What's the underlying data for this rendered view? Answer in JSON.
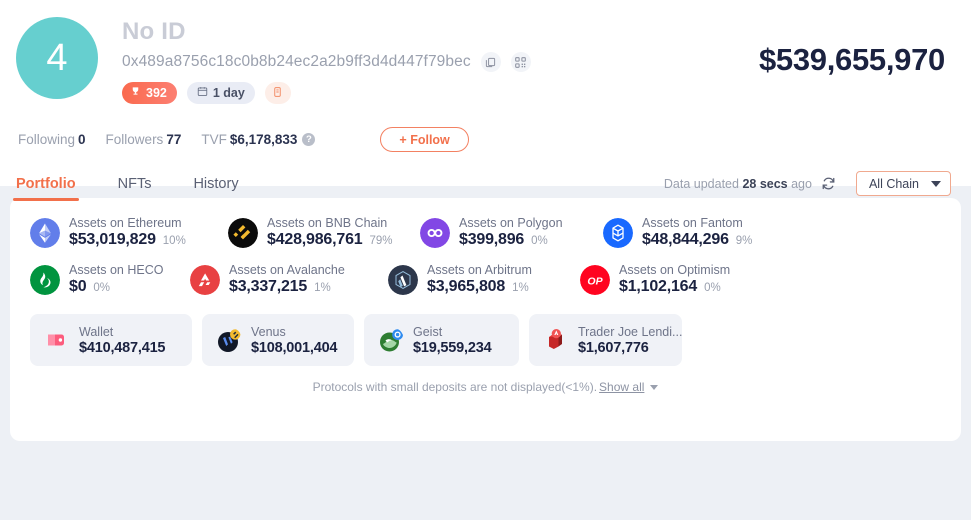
{
  "profile": {
    "avatar_rank": "4",
    "display_name": "No ID",
    "address": "0x489a8756c18c0b8b24ec2a2b9ff3d4d447f79bec",
    "copy_icon": "copy-icon",
    "qr_icon": "qr-code-icon",
    "badges": {
      "rank_icon": "trophy-icon",
      "rank_value": "392",
      "duration_icon": "calendar-icon",
      "duration_value": "1 day",
      "note_icon": "note-icon"
    },
    "total_value": "$539,655,970"
  },
  "stats": {
    "following_label": "Following",
    "following_value": "0",
    "followers_label": "Followers",
    "followers_value": "77",
    "tvf_label": "TVF",
    "tvf_value": "$6,178,833",
    "tvf_help_icon": "question-mark-icon",
    "follow_button": "+ Follow"
  },
  "tabs": [
    {
      "label": "Portfolio",
      "active": true
    },
    {
      "label": "NFTs",
      "active": false
    },
    {
      "label": "History",
      "active": false
    }
  ],
  "toolbar": {
    "updated_prefix": "Data updated",
    "updated_time": "28 secs",
    "updated_suffix": "ago",
    "refresh_icon": "refresh-icon",
    "chain_filter": "All Chain",
    "chain_caret_icon": "chevron-down-icon"
  },
  "chains": [
    {
      "name": "Assets on Ethereum",
      "amount": "$53,019,829",
      "percent": "10%",
      "icon": "ethereum-icon",
      "color": "#627EEA"
    },
    {
      "name": "Assets on BNB Chain",
      "amount": "$428,986,761",
      "percent": "79%",
      "icon": "bnb-icon",
      "color": "#0B0B0B"
    },
    {
      "name": "Assets on Polygon",
      "amount": "$399,896",
      "percent": "0%",
      "icon": "polygon-icon",
      "color": "#8247E5"
    },
    {
      "name": "Assets on Fantom",
      "amount": "$48,844,296",
      "percent": "9%",
      "icon": "fantom-icon",
      "color": "#1969FF"
    },
    {
      "name": "Assets on HECO",
      "amount": "$0",
      "percent": "0%",
      "icon": "heco-icon",
      "color": "#01943F"
    },
    {
      "name": "Assets on Avalanche",
      "amount": "$3,337,215",
      "percent": "1%",
      "icon": "avalanche-icon",
      "color": "#E84142"
    },
    {
      "name": "Assets on Arbitrum",
      "amount": "$3,965,808",
      "percent": "1%",
      "icon": "arbitrum-icon",
      "color": "#2D374B"
    },
    {
      "name": "Assets on Optimism",
      "amount": "$1,102,164",
      "percent": "0%",
      "icon": "optimism-icon",
      "color": "#FF0420"
    }
  ],
  "protocols": [
    {
      "name": "Wallet",
      "amount": "$410,487,415",
      "icon": "wallet-icon"
    },
    {
      "name": "Venus",
      "amount": "$108,001,404",
      "icon": "venus-icon"
    },
    {
      "name": "Geist",
      "amount": "$19,559,234",
      "icon": "geist-icon"
    },
    {
      "name": "Trader Joe Lendi...",
      "amount": "$1,607,776",
      "icon": "trader-joe-icon"
    }
  ],
  "footnote": {
    "text": "Protocols with small deposits are not displayed(<1%).",
    "show_all": "Show all",
    "caret_icon": "chevron-down-icon"
  }
}
